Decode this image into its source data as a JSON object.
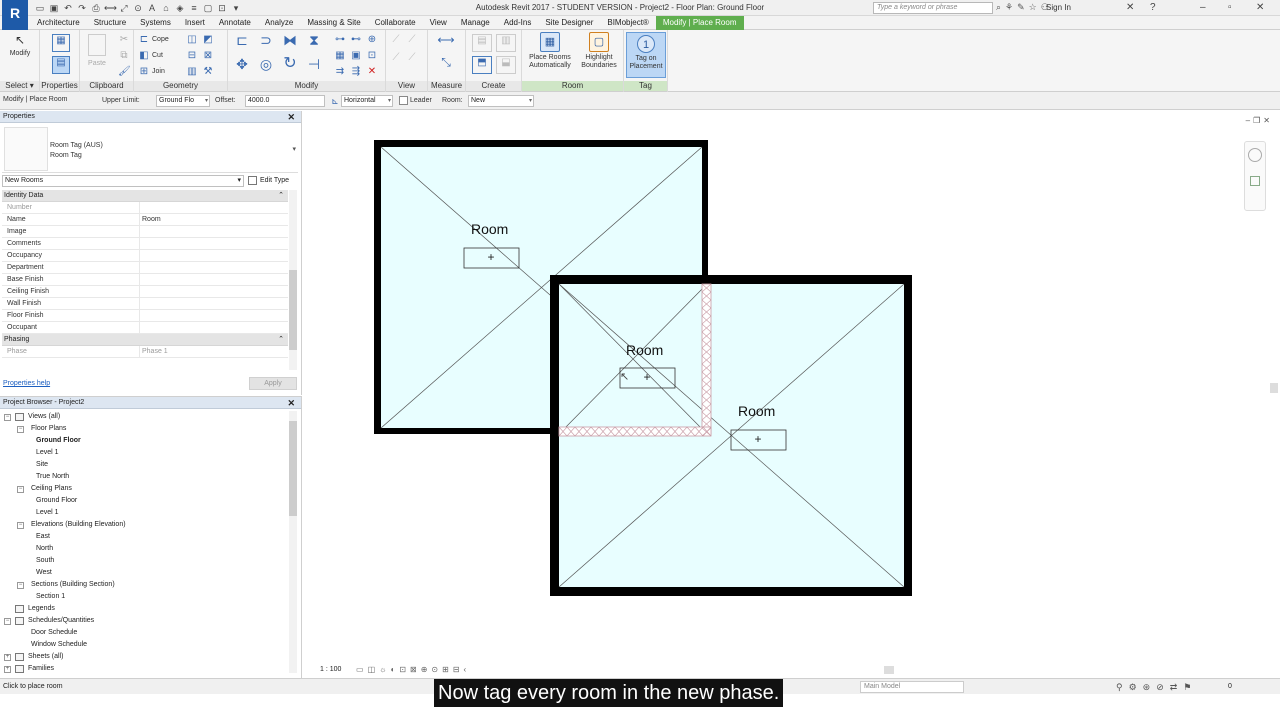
{
  "app": {
    "logo": "R",
    "logo_sub": "",
    "window_title": "Autodesk Revit 2017 -  STUDENT VERSION -     Project2 - Floor Plan: Ground Floor",
    "search_placeholder": "Type a keyword or phrase",
    "sign_in": "Sign In"
  },
  "tabs": [
    "Architecture",
    "Structure",
    "Systems",
    "Insert",
    "Annotate",
    "Analyze",
    "Massing & Site",
    "Collaborate",
    "View",
    "Manage",
    "Add-Ins",
    "Site Designer",
    "BIMobject®",
    "Modify | Place Room"
  ],
  "ribbon": {
    "select": {
      "button": "Modify",
      "label": "Select"
    },
    "properties": {
      "label": "Properties"
    },
    "clipboard": {
      "paste": "Paste",
      "label": "Clipboard"
    },
    "geometry": {
      "cope": "Cope",
      "cut": "Cut",
      "join": "Join",
      "label": "Geometry"
    },
    "modify": {
      "label": "Modify"
    },
    "view": {
      "label": "View"
    },
    "measure": {
      "label": "Measure"
    },
    "create": {
      "label": "Create"
    },
    "room": {
      "place_auto": "Place Rooms Automatically",
      "highlight": "Highlight Boundaries",
      "label": "Room"
    },
    "tag": {
      "tag_on_placement": "Tag on Placement",
      "label": "Tag"
    }
  },
  "options_bar": {
    "context": "Modify | Place Room",
    "upper_limit_label": "Upper Limit:",
    "upper_limit_value": "Ground Flo",
    "offset_label": "Offset:",
    "offset_value": "4000.0",
    "orientation": "Horizontal",
    "leader_label": "Leader",
    "room_label": "Room:",
    "room_value": "New"
  },
  "properties": {
    "title": "Properties",
    "type_family": "Room Tag (AUS)",
    "type_name": "Room Tag",
    "instance_filter": "New Rooms",
    "edit_type": "Edit Type",
    "groups": [
      {
        "name": "Identity Data",
        "rows": [
          {
            "key": "Number",
            "value": "",
            "readonly": true
          },
          {
            "key": "Name",
            "value": "Room",
            "readonly": false
          },
          {
            "key": "Image",
            "value": "",
            "readonly": false
          },
          {
            "key": "Comments",
            "value": "",
            "readonly": false
          },
          {
            "key": "Occupancy",
            "value": "",
            "readonly": false
          },
          {
            "key": "Department",
            "value": "",
            "readonly": false
          },
          {
            "key": "Base Finish",
            "value": "",
            "readonly": false
          },
          {
            "key": "Ceiling Finish",
            "value": "",
            "readonly": false
          },
          {
            "key": "Wall Finish",
            "value": "",
            "readonly": false
          },
          {
            "key": "Floor Finish",
            "value": "",
            "readonly": false
          },
          {
            "key": "Occupant",
            "value": "",
            "readonly": false
          }
        ]
      },
      {
        "name": "Phasing",
        "rows": [
          {
            "key": "Phase",
            "value": "Phase 1",
            "readonly": true
          }
        ]
      }
    ],
    "help_link": "Properties help",
    "apply": "Apply"
  },
  "browser": {
    "title": "Project Browser - Project2",
    "nodes": [
      {
        "label": "Views (all)",
        "level": 0,
        "expander": "−",
        "icon": true
      },
      {
        "label": "Floor Plans",
        "level": 1,
        "expander": "−"
      },
      {
        "label": "Ground Floor",
        "level": 2,
        "bold": true
      },
      {
        "label": "Level 1",
        "level": 2
      },
      {
        "label": "Site",
        "level": 2
      },
      {
        "label": "True North",
        "level": 2
      },
      {
        "label": "Ceiling Plans",
        "level": 1,
        "expander": "−"
      },
      {
        "label": "Ground Floor",
        "level": 2
      },
      {
        "label": "Level 1",
        "level": 2
      },
      {
        "label": "Elevations (Building Elevation)",
        "level": 1,
        "expander": "−"
      },
      {
        "label": "East",
        "level": 2
      },
      {
        "label": "North",
        "level": 2
      },
      {
        "label": "South",
        "level": 2
      },
      {
        "label": "West",
        "level": 2
      },
      {
        "label": "Sections (Building Section)",
        "level": 1,
        "expander": "−"
      },
      {
        "label": "Section 1",
        "level": 2
      },
      {
        "label": "Legends",
        "level": 0,
        "icon": true
      },
      {
        "label": "Schedules/Quantities",
        "level": 0,
        "expander": "−",
        "icon": true
      },
      {
        "label": "Door Schedule",
        "level": 1
      },
      {
        "label": "Window Schedule",
        "level": 1
      },
      {
        "label": "Sheets (all)",
        "level": 0,
        "expander": "+",
        "icon": true
      },
      {
        "label": "Families",
        "level": 0,
        "expander": "+",
        "icon": true
      }
    ]
  },
  "canvas": {
    "scale": "1 : 100",
    "rooms": [
      {
        "label": "Room"
      },
      {
        "label": "Room"
      },
      {
        "label": "Room"
      }
    ],
    "colors": {
      "room_fill": "#e8feff",
      "wall": "#000000",
      "boundary": "#c89ca6"
    }
  },
  "status": {
    "text": "Click to place room",
    "model": "Main Model",
    "count": "0"
  },
  "caption": "Now tag every room in the new phase."
}
